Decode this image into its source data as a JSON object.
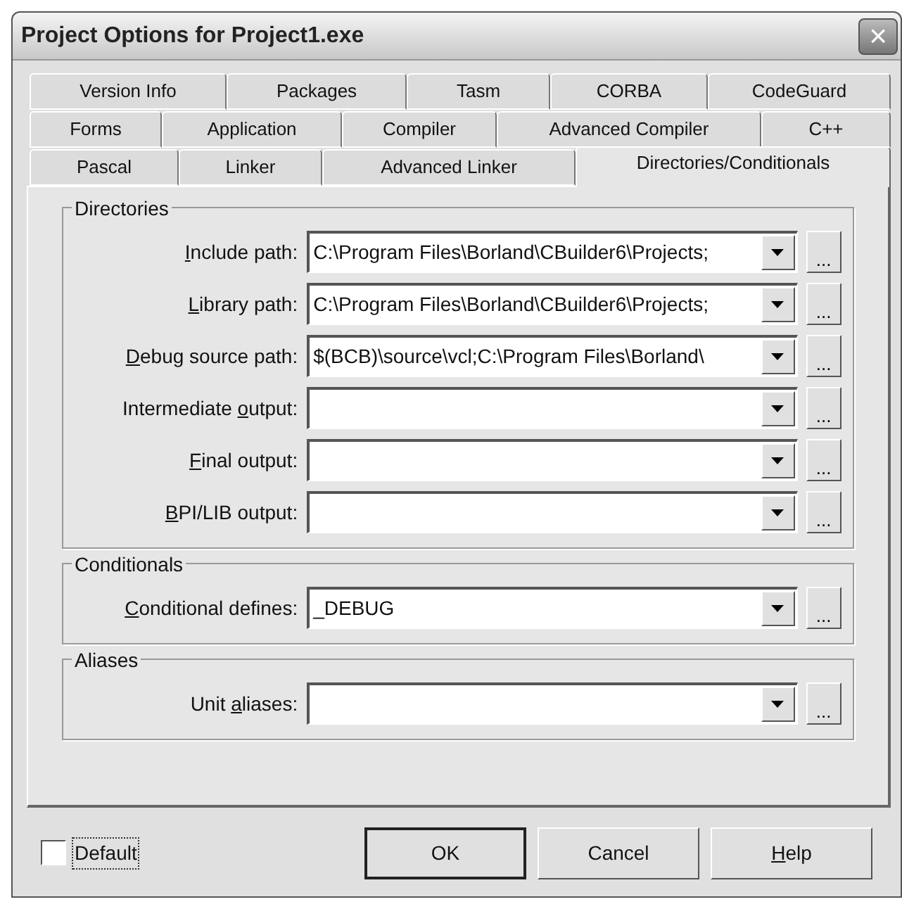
{
  "window": {
    "title": "Project Options for Project1.exe",
    "close": "×"
  },
  "tab_rows": [
    [
      {
        "label": "Version Info",
        "selected": false
      },
      {
        "label": "Packages",
        "selected": false
      },
      {
        "label": "Tasm",
        "selected": false
      },
      {
        "label": "CORBA",
        "selected": false
      },
      {
        "label": "CodeGuard",
        "selected": false
      }
    ],
    [
      {
        "label": "Forms",
        "selected": false
      },
      {
        "label": "Application",
        "selected": false
      },
      {
        "label": "Compiler",
        "selected": false
      },
      {
        "label": "Advanced Compiler",
        "selected": false
      },
      {
        "label": "C++",
        "selected": false
      }
    ],
    [
      {
        "label": "Pascal",
        "selected": false
      },
      {
        "label": "Linker",
        "selected": false
      },
      {
        "label": "Advanced Linker",
        "selected": false
      },
      {
        "label": "Directories/Conditionals",
        "selected": true
      }
    ]
  ],
  "groups": [
    {
      "title": "Directories",
      "fields": [
        {
          "label_key": "I",
          "label_post": "nclude path:",
          "value": "C:\\Program Files\\Borland\\CBuilder6\\Projects;",
          "browse": "..."
        },
        {
          "label_key": "L",
          "label_post": "ibrary path:",
          "value": "C:\\Program Files\\Borland\\CBuilder6\\Projects;",
          "browse": "..."
        },
        {
          "label_key": "D",
          "label_post": "ebug source path:",
          "value": "$(BCB)\\source\\vcl;C:\\Program Files\\Borland\\",
          "browse": "..."
        },
        {
          "label_pre": "Intermediate ",
          "label_key": "o",
          "label_post": "utput:",
          "browse": "..."
        },
        {
          "label_key": "F",
          "label_post": "inal output:",
          "browse": "..."
        },
        {
          "label_key": "B",
          "label_post": "PI/LIB output:",
          "browse": "..."
        }
      ]
    },
    {
      "title": "Conditionals",
      "fields": [
        {
          "label_key": "C",
          "label_post": "onditional defines:",
          "value": "_DEBUG",
          "browse": "..."
        }
      ]
    },
    {
      "title": "Aliases",
      "fields": [
        {
          "label_pre": "Unit ",
          "label_key": "a",
          "label_post": "liases:",
          "browse": "..."
        }
      ]
    }
  ],
  "default_checkbox": {
    "label": "Default",
    "checked": false
  },
  "buttons": [
    {
      "label_post": "OK",
      "default": true
    },
    {
      "label_post": "Cancel",
      "default": false
    },
    {
      "label_key": "H",
      "label_post": "elp",
      "default": false
    }
  ]
}
